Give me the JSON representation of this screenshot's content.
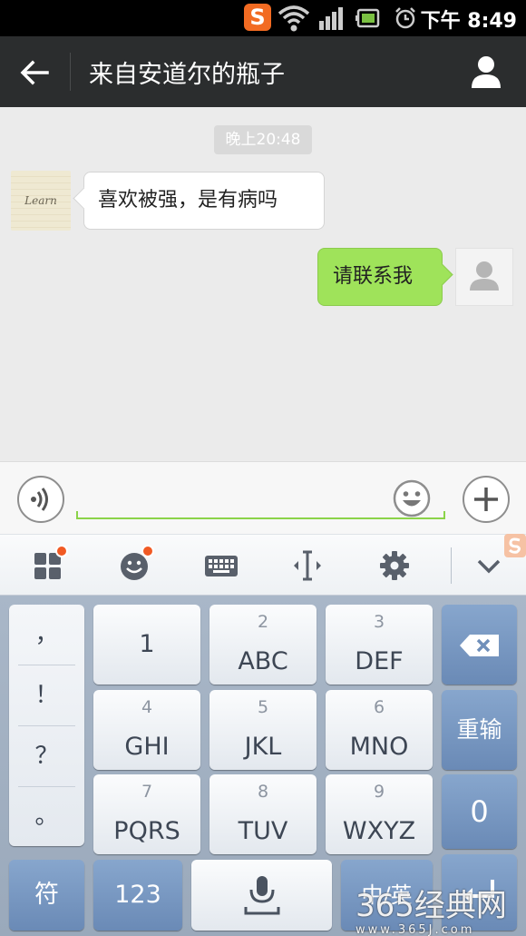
{
  "status_bar": {
    "time": "下午 8:49",
    "app_icon": "sogou-icon",
    "icons": [
      "wifi-icon",
      "signal-icon",
      "battery-icon",
      "alarm-icon"
    ]
  },
  "title_bar": {
    "title": "来自安道尔的瓶子",
    "back_icon": "back-arrow-icon",
    "profile_icon": "profile-icon"
  },
  "chat": {
    "timestamp": "晚上20:48",
    "messages": [
      {
        "side": "left",
        "text": "喜欢被强，是有病吗",
        "avatar": "Learn"
      },
      {
        "side": "right",
        "text": "请联系我",
        "avatar": "default-avatar-icon"
      }
    ]
  },
  "input_bar": {
    "value": "",
    "voice_icon": "voice-icon",
    "emoji_icon": "emoji-icon",
    "plus_icon": "plus-icon"
  },
  "keyboard_toolbar": {
    "items": [
      "apps-icon",
      "emoji-icon",
      "keyboard-icon",
      "cursor-icon",
      "gear-icon",
      "chevron-down-icon"
    ]
  },
  "keyboard": {
    "punctuation": [
      "，",
      "！",
      "？",
      "。"
    ],
    "rows": [
      [
        {
          "sub": "",
          "main": "1"
        },
        {
          "sub": "2",
          "main": "ABC"
        },
        {
          "sub": "3",
          "main": "DEF"
        }
      ],
      [
        {
          "sub": "4",
          "main": "GHI"
        },
        {
          "sub": "5",
          "main": "JKL"
        },
        {
          "sub": "6",
          "main": "MNO"
        }
      ],
      [
        {
          "sub": "7",
          "main": "PQRS"
        },
        {
          "sub": "8",
          "main": "TUV"
        },
        {
          "sub": "9",
          "main": "WXYZ"
        }
      ]
    ],
    "backspace_icon": "backspace-icon",
    "reinput": "重输",
    "zero": "0",
    "symbols": "符",
    "numbers": "123",
    "space_icon": "microphone-icon",
    "lang_switch": "中/英",
    "enter_icon": "enter-icon"
  },
  "watermark": {
    "text": "365经典网",
    "url": "www.365J.com"
  },
  "colors": {
    "title_bar": "#2b2d2e",
    "sent_bubble": "#9fe35a",
    "accent_line": "#8bd349",
    "notification_dot": "#f15a24"
  }
}
